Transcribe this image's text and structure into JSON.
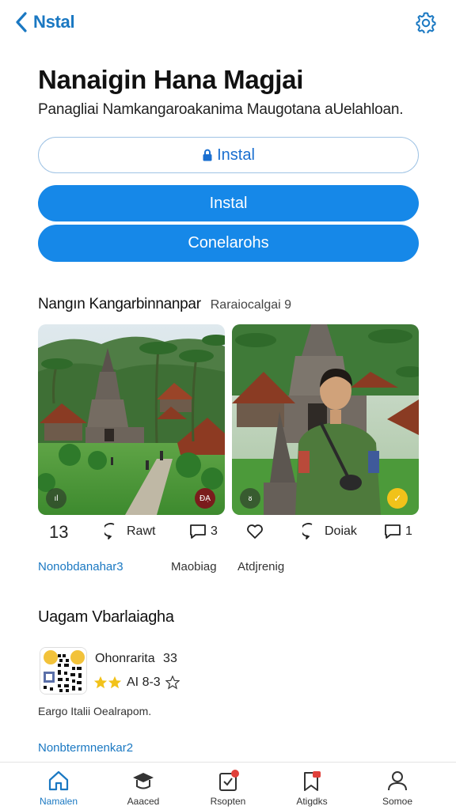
{
  "header": {
    "back_label": "Nstal"
  },
  "app": {
    "title": "Nanaigin Hana Magjai",
    "subtitle": "Panagliai Namkangaroakanima Maugotana aUelahloan."
  },
  "buttons": {
    "install_outline": "Instal",
    "install_primary": "Instal",
    "secondary": "Conelarohs"
  },
  "gallery": {
    "title": "Nangın Kangarbinnanpar",
    "count": "Raraiocalgai 9",
    "card1_badges": [
      "ıl",
      "ĐẠ"
    ],
    "card2_badges": [
      "ᴕ",
      "✓"
    ]
  },
  "actions": {
    "left_count": "13",
    "left_share": "Rawt",
    "left_comments": "3",
    "right_share": "Doiak",
    "right_comments": "1"
  },
  "links": {
    "first": "Nonobdanahar3",
    "second": "Maobiag",
    "third": "Atdjrenig"
  },
  "listing_section": {
    "title": "Uagam Vbarlaiagha",
    "name": "Ohonrarita",
    "name_count": "33",
    "rating_text": "AI 8-3",
    "description": "Eargo Italii Oealrapom.",
    "more_link": "Nonbtermnenkar2"
  },
  "tabs": [
    {
      "label": "Namalen",
      "icon": "home-icon"
    },
    {
      "label": "Aaaced",
      "icon": "graduation-cap-icon"
    },
    {
      "label": "Rsopten",
      "icon": "clipboard-icon"
    },
    {
      "label": "Atigdks",
      "icon": "bookmark-list-icon"
    },
    {
      "label": "Somoe",
      "icon": "person-icon"
    }
  ],
  "colors": {
    "accent": "#1688e8",
    "link": "#1a78c2",
    "notification": "#e0403a"
  }
}
